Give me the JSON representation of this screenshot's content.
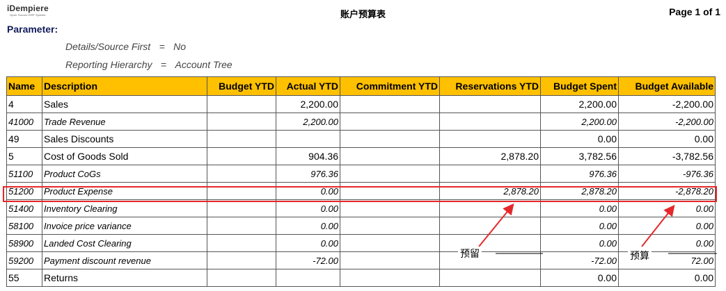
{
  "header": {
    "logo_text": "iDempiere",
    "logo_subtext": "Open Source ERP System",
    "title": "账户预算表",
    "page_label": "Page 1 of 1"
  },
  "parameters": {
    "label": "Parameter:",
    "items": [
      {
        "name": "Details/Source First",
        "op": "=",
        "value": "No"
      },
      {
        "name": "Reporting Hierarchy",
        "op": "=",
        "value": "Account Tree"
      }
    ]
  },
  "table": {
    "columns": [
      "Name",
      "Description",
      "Budget YTD",
      "Actual YTD",
      "Commitment YTD",
      "Reservations YTD",
      "Budget Spent",
      "Budget Available"
    ],
    "rows": [
      {
        "name": "4",
        "description": "Sales",
        "budget_ytd": "",
        "actual_ytd": "2,200.00",
        "commitment_ytd": "",
        "reservations_ytd": "",
        "budget_spent": "2,200.00",
        "budget_available": "-2,200.00"
      },
      {
        "name": "41000",
        "description": "Trade Revenue",
        "budget_ytd": "",
        "actual_ytd": "2,200.00",
        "commitment_ytd": "",
        "reservations_ytd": "",
        "budget_spent": "2,200.00",
        "budget_available": "-2,200.00"
      },
      {
        "name": "49",
        "description": "Sales Discounts",
        "budget_ytd": "",
        "actual_ytd": "",
        "commitment_ytd": "",
        "reservations_ytd": "",
        "budget_spent": "0.00",
        "budget_available": "0.00"
      },
      {
        "name": "5",
        "description": "Cost of Goods Sold",
        "budget_ytd": "",
        "actual_ytd": "904.36",
        "commitment_ytd": "",
        "reservations_ytd": "2,878.20",
        "budget_spent": "3,782.56",
        "budget_available": "-3,782.56"
      },
      {
        "name": "51100",
        "description": "Product CoGs",
        "budget_ytd": "",
        "actual_ytd": "976.36",
        "commitment_ytd": "",
        "reservations_ytd": "",
        "budget_spent": "976.36",
        "budget_available": "-976.36"
      },
      {
        "name": "51200",
        "description": "Product Expense",
        "budget_ytd": "",
        "actual_ytd": "0.00",
        "commitment_ytd": "",
        "reservations_ytd": "2,878.20",
        "budget_spent": "2,878.20",
        "budget_available": "-2,878.20"
      },
      {
        "name": "51400",
        "description": "Inventory Clearing",
        "budget_ytd": "",
        "actual_ytd": "0.00",
        "commitment_ytd": "",
        "reservations_ytd": "",
        "budget_spent": "0.00",
        "budget_available": "0.00"
      },
      {
        "name": "58100",
        "description": "Invoice price variance",
        "budget_ytd": "",
        "actual_ytd": "0.00",
        "commitment_ytd": "",
        "reservations_ytd": "",
        "budget_spent": "0.00",
        "budget_available": "0.00"
      },
      {
        "name": "58900",
        "description": "Landed Cost Clearing",
        "budget_ytd": "",
        "actual_ytd": "0.00",
        "commitment_ytd": "",
        "reservations_ytd": "",
        "budget_spent": "0.00",
        "budget_available": "0.00"
      },
      {
        "name": "59200",
        "description": "Payment discount revenue",
        "budget_ytd": "",
        "actual_ytd": "-72.00",
        "commitment_ytd": "",
        "reservations_ytd": "",
        "budget_spent": "-72.00",
        "budget_available": "72.00"
      },
      {
        "name": "55",
        "description": "Returns",
        "budget_ytd": "",
        "actual_ytd": "",
        "commitment_ytd": "",
        "reservations_ytd": "",
        "budget_spent": "0.00",
        "budget_available": "0.00"
      }
    ]
  },
  "annotations": {
    "reservation_note": "预留",
    "budget_note": "预算",
    "highlight_color": "#e5282a",
    "header_color": "#ffc000"
  }
}
